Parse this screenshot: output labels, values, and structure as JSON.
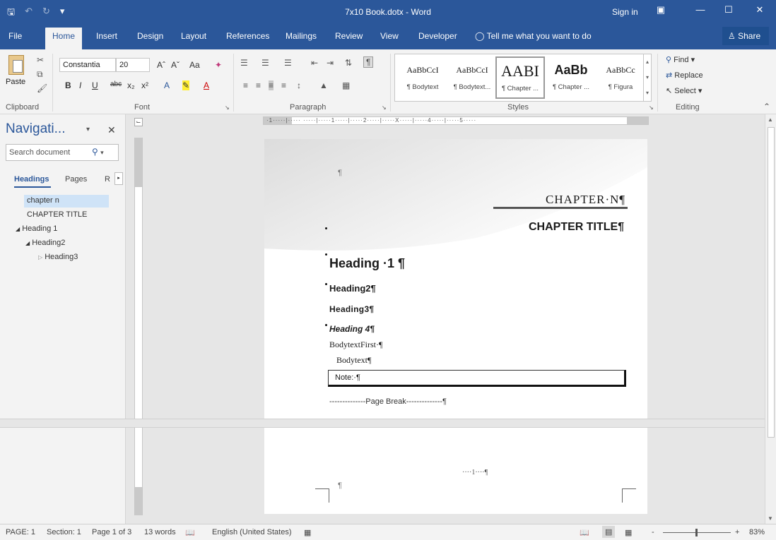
{
  "window": {
    "title": "7x10 Book.dotx  -  Word",
    "sign_in": "Sign in",
    "qat_icons": [
      "save-icon",
      "undo-icon",
      "redo-icon",
      "customize-icon"
    ]
  },
  "ribbon_tabs": [
    "File",
    "Home",
    "Insert",
    "Design",
    "Layout",
    "References",
    "Mailings",
    "Review",
    "View",
    "Developer"
  ],
  "active_tab": "Home",
  "tell_me": "Tell me what you want to do",
  "share": "Share",
  "clipboard": {
    "paste": "Paste",
    "group": "Clipboard"
  },
  "font": {
    "name": "Constantia",
    "size": "20",
    "group": "Font",
    "buttons": [
      "B",
      "I",
      "U",
      "abc",
      "x₂",
      "x²",
      "A",
      "A",
      "Aa",
      "A",
      "A"
    ]
  },
  "paragraph": {
    "group": "Paragraph"
  },
  "styles": {
    "group": "Styles",
    "items": [
      {
        "preview": "AaBbCcI",
        "name": "¶ Bodytext"
      },
      {
        "preview": "AaBbCcI",
        "name": "¶ Bodytext..."
      },
      {
        "preview": "AABI",
        "name": "¶ Chapter ..."
      },
      {
        "preview": "AaBb",
        "name": "¶ Chapter ..."
      },
      {
        "preview": "AaBbCc",
        "name": "¶ Figura"
      }
    ],
    "selected_index": 2
  },
  "editing": {
    "group": "Editing",
    "find": "Find",
    "replace": "Replace",
    "select": "Select"
  },
  "nav": {
    "title": "Navigati...",
    "search_placeholder": "Search document",
    "tabs": [
      "Headings",
      "Pages",
      "R"
    ],
    "items": [
      {
        "label": "chapter n",
        "level": 0,
        "selected": true
      },
      {
        "label": "CHAPTER TITLE",
        "level": 0
      },
      {
        "label": "Heading 1",
        "level": 0,
        "expanded": true
      },
      {
        "label": "Heading2",
        "level": 1,
        "expanded": true
      },
      {
        "label": "Heading3",
        "level": 2
      }
    ]
  },
  "document": {
    "chapter_n": "CHAPTER·N¶",
    "chapter_title": "CHAPTER TITLE¶",
    "heading1": "Heading ·1 ¶",
    "heading2": "Heading2¶",
    "heading3": "Heading3¶",
    "heading4": "Heading 4¶",
    "bodytext_first": "BodytextFirst·¶",
    "bodytext": "Bodytext¶",
    "note": "Note:·¶",
    "page_break": "--------------Page Break--------------¶",
    "pilcrow": "¶",
    "footer_page": "····1····¶"
  },
  "statusbar": {
    "page": "PAGE: 1",
    "section": "Section: 1",
    "page_of": "Page 1 of 3",
    "words": "13 words",
    "language": "English (United States)",
    "zoom": "83%",
    "zoom_minus": "-",
    "zoom_plus": "+"
  },
  "colors": {
    "accent": "#2b579a",
    "ribbon_bg": "#f3f3f3",
    "workspace": "#e6e6e6"
  }
}
